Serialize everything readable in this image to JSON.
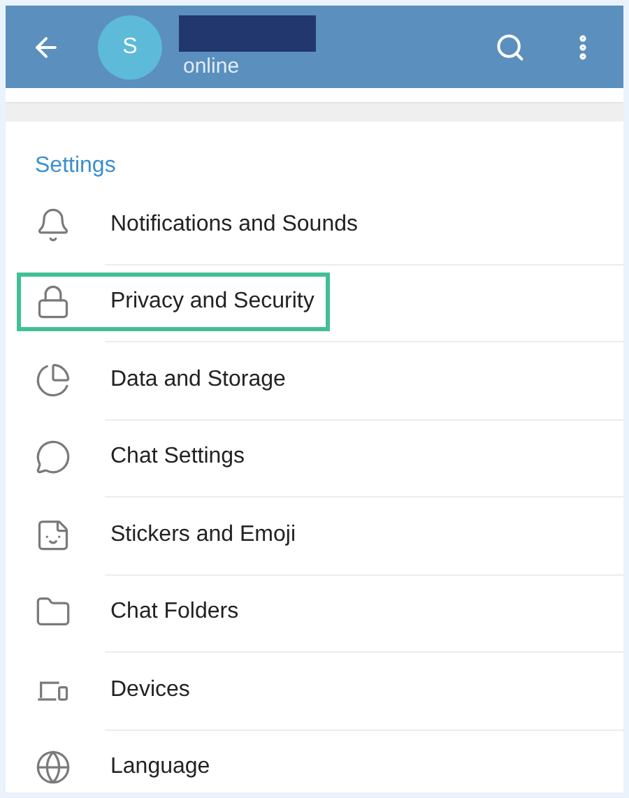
{
  "header": {
    "avatar_letter": "S",
    "name_redacted": true,
    "status": "online"
  },
  "section": {
    "title": "Settings"
  },
  "items": [
    {
      "label": "Notifications and Sounds",
      "kind": "bell",
      "highlighted": false
    },
    {
      "label": "Privacy and Security",
      "kind": "lock",
      "highlighted": true
    },
    {
      "label": "Data and Storage",
      "kind": "pie",
      "highlighted": false
    },
    {
      "label": "Chat Settings",
      "kind": "chat",
      "highlighted": false
    },
    {
      "label": "Stickers and Emoji",
      "kind": "sticker",
      "highlighted": false
    },
    {
      "label": "Chat Folders",
      "kind": "folder",
      "highlighted": false
    },
    {
      "label": "Devices",
      "kind": "devices",
      "highlighted": false
    },
    {
      "label": "Language",
      "kind": "globe",
      "highlighted": false
    }
  ]
}
